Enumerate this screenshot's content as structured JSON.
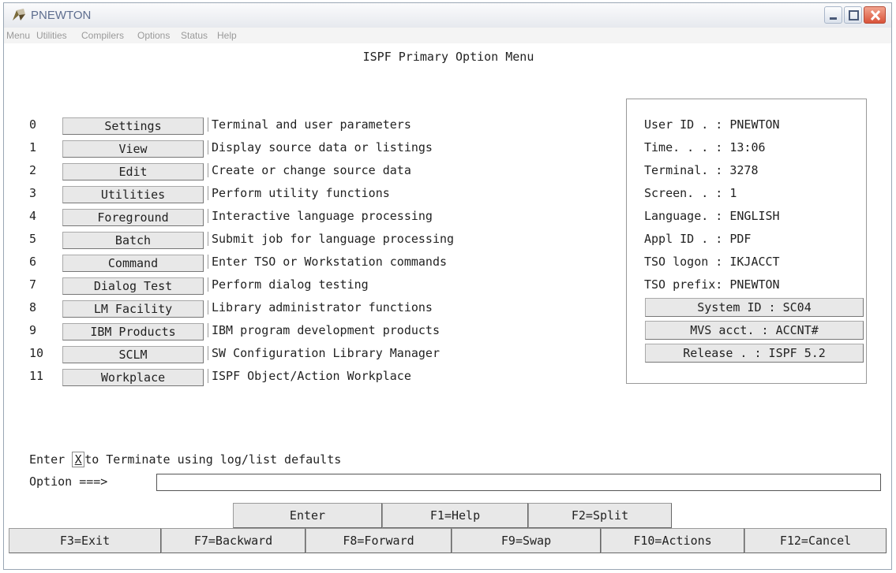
{
  "window": {
    "title": "PNEWTON"
  },
  "menu": [
    "Menu",
    "Utilities",
    "Compilers",
    "Options",
    "Status",
    "Help"
  ],
  "panel_title": "ISPF Primary Option Menu",
  "options": [
    {
      "num": "0",
      "label": "Settings",
      "desc": "Terminal and user parameters"
    },
    {
      "num": "1",
      "label": "View",
      "desc": "Display source data or listings"
    },
    {
      "num": "2",
      "label": "Edit",
      "desc": "Create or change source data"
    },
    {
      "num": "3",
      "label": "Utilities",
      "desc": "Perform utility functions"
    },
    {
      "num": "4",
      "label": "Foreground",
      "desc": "Interactive language processing"
    },
    {
      "num": "5",
      "label": "Batch",
      "desc": "Submit job for language processing"
    },
    {
      "num": "6",
      "label": "Command",
      "desc": "Enter TSO or Workstation commands"
    },
    {
      "num": "7",
      "label": "Dialog Test",
      "desc": "Perform dialog testing"
    },
    {
      "num": "8",
      "label": "LM Facility",
      "desc": "Library administrator functions"
    },
    {
      "num": "9",
      "label": "IBM Products",
      "desc": "IBM program development products"
    },
    {
      "num": "10",
      "label": "SCLM",
      "desc": "SW Configuration Library Manager"
    },
    {
      "num": "11",
      "label": "Workplace",
      "desc": "ISPF Object/Action Workplace"
    }
  ],
  "info": {
    "lines": [
      "User ID . : PNEWTON",
      "Time. . . : 13:06",
      "Terminal. : 3278",
      "Screen. . : 1",
      "Language. : ENGLISH",
      "Appl ID . : PDF",
      "TSO logon : IKJACCT",
      "TSO prefix: PNEWTON"
    ],
    "buttons": [
      "System ID : SC04",
      "MVS acct. : ACCNT#",
      "Release . : ISPF 5.2"
    ]
  },
  "terminate": {
    "prefix": "Enter ",
    "key": "X",
    "suffix": "to Terminate using log/list defaults"
  },
  "option_prompt": "Option ===>",
  "option_value": "",
  "fkeys_row1": [
    "Enter",
    "F1=Help",
    "F2=Split"
  ],
  "fkeys_row2": [
    "F3=Exit",
    "F7=Backward",
    "F8=Forward",
    "F9=Swap",
    "F10=Actions",
    "F12=Cancel"
  ]
}
